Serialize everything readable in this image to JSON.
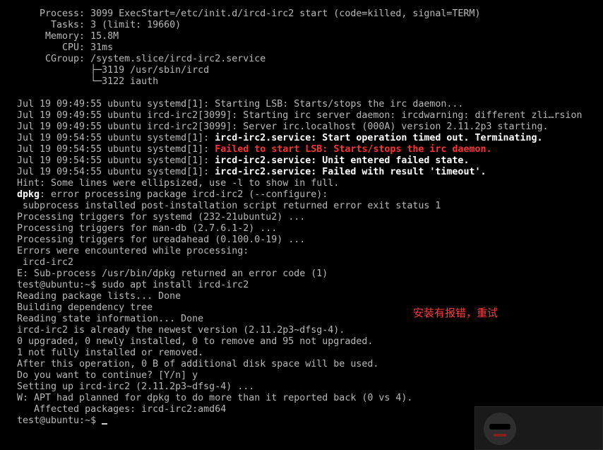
{
  "terminal": {
    "lines": [
      {
        "segments": [
          {
            "text": "    Process: 3099 ExecStart=/etc/init.d/ircd-irc2 start (code=killed, signal=TERM)",
            "style": "normal"
          }
        ]
      },
      {
        "segments": [
          {
            "text": "      Tasks: 3 (limit: 19660)",
            "style": "normal"
          }
        ]
      },
      {
        "segments": [
          {
            "text": "     Memory: 15.8M",
            "style": "normal"
          }
        ]
      },
      {
        "segments": [
          {
            "text": "        CPU: 31ms",
            "style": "normal"
          }
        ]
      },
      {
        "segments": [
          {
            "text": "     CGroup: /system.slice/ircd-irc2.service",
            "style": "normal"
          }
        ]
      },
      {
        "segments": [
          {
            "text": "             ├─3119 /usr/sbin/ircd",
            "style": "normal"
          }
        ]
      },
      {
        "segments": [
          {
            "text": "             └─3122 iauth",
            "style": "normal"
          }
        ]
      },
      {
        "segments": [
          {
            "text": "",
            "style": "normal"
          }
        ]
      },
      {
        "segments": [
          {
            "text": "Jul 19 09:49:55 ubuntu systemd[1]: Starting LSB: Starts/stops the irc daemon...",
            "style": "normal"
          }
        ]
      },
      {
        "segments": [
          {
            "text": "Jul 19 09:49:55 ubuntu ircd-irc2[3099]: Starting irc server daemon: ircdwarning: different zli…rsion",
            "style": "normal"
          }
        ]
      },
      {
        "segments": [
          {
            "text": "Jul 19 09:49:55 ubuntu ircd-irc2[3099]: Server irc.localhost (000A) version 2.11.2p3 starting.",
            "style": "normal"
          }
        ]
      },
      {
        "segments": [
          {
            "text": "Jul 19 09:54:55 ubuntu systemd[1]: ",
            "style": "normal"
          },
          {
            "text": "ircd-irc2.service: Start operation timed out. Terminating.",
            "style": "bold"
          }
        ]
      },
      {
        "segments": [
          {
            "text": "Jul 19 09:54:55 ubuntu systemd[1]: ",
            "style": "normal"
          },
          {
            "text": "Failed to start LSB: Starts/stops the irc daemon.",
            "style": "red"
          }
        ]
      },
      {
        "segments": [
          {
            "text": "Jul 19 09:54:55 ubuntu systemd[1]: ",
            "style": "normal"
          },
          {
            "text": "ircd-irc2.service: Unit entered failed state.",
            "style": "bold"
          }
        ]
      },
      {
        "segments": [
          {
            "text": "Jul 19 09:54:55 ubuntu systemd[1]: ",
            "style": "normal"
          },
          {
            "text": "ircd-irc2.service: Failed with result 'timeout'.",
            "style": "bold"
          }
        ]
      },
      {
        "segments": [
          {
            "text": "Hint: Some lines were ellipsized, use -l to show in full.",
            "style": "normal"
          }
        ]
      },
      {
        "segments": [
          {
            "text": "dpkg",
            "style": "bold"
          },
          {
            "text": ": error processing package ircd-irc2 (--configure):",
            "style": "normal"
          }
        ]
      },
      {
        "segments": [
          {
            "text": " subprocess installed post-installation script returned error exit status 1",
            "style": "normal"
          }
        ]
      },
      {
        "segments": [
          {
            "text": "Processing triggers for systemd (232-21ubuntu2) ...",
            "style": "normal"
          }
        ]
      },
      {
        "segments": [
          {
            "text": "Processing triggers for man-db (2.7.6.1-2) ...",
            "style": "normal"
          }
        ]
      },
      {
        "segments": [
          {
            "text": "Processing triggers for ureadahead (0.100.0-19) ...",
            "style": "normal"
          }
        ]
      },
      {
        "segments": [
          {
            "text": "Errors were encountered while processing:",
            "style": "normal"
          }
        ]
      },
      {
        "segments": [
          {
            "text": " ircd-irc2",
            "style": "normal"
          }
        ]
      },
      {
        "segments": [
          {
            "text": "E: Sub-process /usr/bin/dpkg returned an error code (1)",
            "style": "normal"
          }
        ]
      },
      {
        "segments": [
          {
            "text": "test@ubuntu:~$ sudo apt install ircd-irc2",
            "style": "normal"
          }
        ]
      },
      {
        "segments": [
          {
            "text": "Reading package lists... Done",
            "style": "normal"
          }
        ]
      },
      {
        "segments": [
          {
            "text": "Building dependency tree",
            "style": "normal"
          }
        ]
      },
      {
        "segments": [
          {
            "text": "Reading state information... Done",
            "style": "normal"
          }
        ]
      },
      {
        "segments": [
          {
            "text": "ircd-irc2 is already the newest version (2.11.2p3~dfsg-4).",
            "style": "normal"
          }
        ]
      },
      {
        "segments": [
          {
            "text": "0 upgraded, 0 newly installed, 0 to remove and 95 not upgraded.",
            "style": "normal"
          }
        ]
      },
      {
        "segments": [
          {
            "text": "1 not fully installed or removed.",
            "style": "normal"
          }
        ]
      },
      {
        "segments": [
          {
            "text": "After this operation, 0 B of additional disk space will be used.",
            "style": "normal"
          }
        ]
      },
      {
        "segments": [
          {
            "text": "Do you want to continue? [Y/n] y",
            "style": "normal"
          }
        ]
      },
      {
        "segments": [
          {
            "text": "Setting up ircd-irc2 (2.11.2p3~dfsg-4) ...",
            "style": "normal"
          }
        ]
      },
      {
        "segments": [
          {
            "text": "W: APT had planned for dpkg to do more than it reported back (0 vs 4).",
            "style": "normal"
          }
        ]
      },
      {
        "segments": [
          {
            "text": "   Affected packages: ircd-irc2:amd64",
            "style": "normal"
          }
        ]
      }
    ],
    "prompt": "test@ubuntu:~$ "
  },
  "annotation": {
    "text": "安装有报错，重试",
    "color": "#ff3b3b"
  },
  "colors": {
    "background": "#000000",
    "text": "#b8b8b8",
    "bold": "#ffffff",
    "error": "#ff3333"
  }
}
